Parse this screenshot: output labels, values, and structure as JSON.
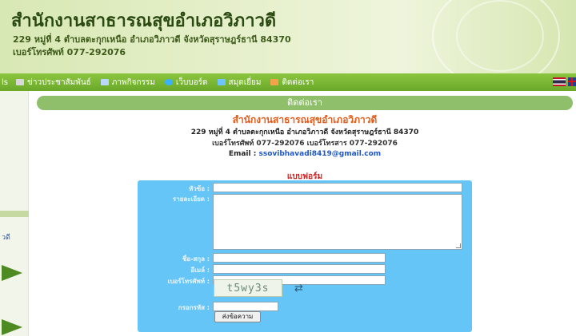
{
  "header": {
    "title": "สำนักงานสาธารณสุขอำเภอวิภาวดี",
    "address": "229 หมู่ที่ 4 ตำบลตะกุกเหนือ อำเภอวิภาวดี จังหวัดสุราษฎร์ธานี 84370",
    "phone": "เบอร์โทรศัพท์ 077-292076"
  },
  "nav": {
    "cut_item": "ls",
    "items": [
      {
        "label": "ข่าวประชาสัมพันธ์",
        "icon": "news-icon",
        "color": "#d8d8d8"
      },
      {
        "label": "ภาพกิจกรรม",
        "icon": "photo-icon",
        "color": "#b9d7ff"
      },
      {
        "label": "เว็บบอร์ด",
        "icon": "webboard-icon",
        "color": "#3ab0ff"
      },
      {
        "label": "สมุดเยี่ยม",
        "icon": "guestbook-icon",
        "color": "#6fc3ff"
      },
      {
        "label": "ติดต่อเรา",
        "icon": "contact-icon",
        "color": "#f3a44a"
      }
    ]
  },
  "sidebar": {
    "cut_text": "วดี"
  },
  "contact": {
    "section_title": "ติดต่อเรา",
    "org_name": "สำนักงานสาธารณสุขอำเภอวิภาวดี",
    "address": "229 หมู่ที่ 4 ตำบลตะกุกเหนือ อำเภอวิภาวดี จังหวัดสุราษฎร์ธานี 84370",
    "phones": "เบอร์โทรศัพท์ 077-292076 เบอร์โทรสาร 077-292076",
    "email_label": "Email :",
    "email": "ssovibhavadi8419@gmail.com"
  },
  "form": {
    "heading": "แบบฟอร์ม",
    "subject_label": "หัวข้อ :",
    "detail_label": "รายละเอียด :",
    "name_label": "ชื่อ-สกุล :",
    "email_label": "อีเมล์ :",
    "phone_label": "เบอร์โทรศัพท์ :",
    "captcha_text": "t5wy3s",
    "code_label": "กรอกรหัส :",
    "submit_label": "ส่งข้อความ",
    "box_color": "#66c5f7"
  },
  "colors": {
    "nav_bg": "#7ab835",
    "title_bar": "#8fbf6a",
    "org_name": "#e25c1a",
    "form_heading": "#d22020",
    "email_link": "#1f57c5"
  }
}
